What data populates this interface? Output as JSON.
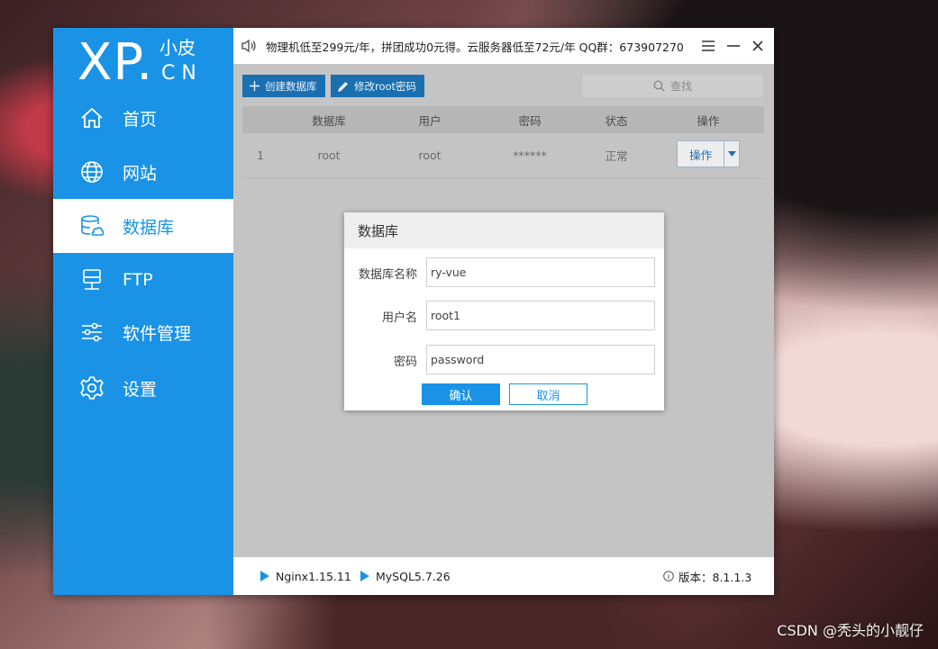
{
  "logo": {
    "main": "XP.",
    "top": "小皮",
    "bottom": "CN"
  },
  "sidebar": {
    "items": [
      {
        "label": "首页",
        "icon": "home-icon"
      },
      {
        "label": "网站",
        "icon": "globe-icon"
      },
      {
        "label": "数据库",
        "icon": "database-icon",
        "active": true
      },
      {
        "label": "FTP",
        "icon": "ftp-server-icon"
      },
      {
        "label": "软件管理",
        "icon": "sliders-icon"
      },
      {
        "label": "设置",
        "icon": "gear-icon"
      }
    ]
  },
  "titlebar": {
    "notice": "物理机低至299元/年，拼团成功0元得。云服务器低至72元/年 QQ群：673907270"
  },
  "toolbar": {
    "create_label": "创建数据库",
    "change_pw_label": "修改root密码",
    "search_placeholder": "查找"
  },
  "table": {
    "headers": [
      "数据库",
      "用户",
      "密码",
      "状态",
      "操作"
    ],
    "rows": [
      {
        "index": "1",
        "database": "root",
        "user": "root",
        "password": "******",
        "status": "正常",
        "action": "操作"
      }
    ]
  },
  "dialog": {
    "title": "数据库",
    "fields": [
      {
        "label": "数据库名称",
        "value": "ry-vue"
      },
      {
        "label": "用户名",
        "value": "root1"
      },
      {
        "label": "密码",
        "value": "password"
      }
    ],
    "confirm_label": "确认",
    "cancel_label": "取消"
  },
  "statusbar": {
    "nginx": "Nginx1.15.11",
    "mysql": "MySQL5.7.26",
    "version": "版本：8.1.1.3"
  },
  "watermark": "CSDN @秃头的小靓仔",
  "colors": {
    "accent": "#1a93e6",
    "toolbar_button": "#1a6fb0",
    "overlay_gray": "#c4c4c4"
  }
}
